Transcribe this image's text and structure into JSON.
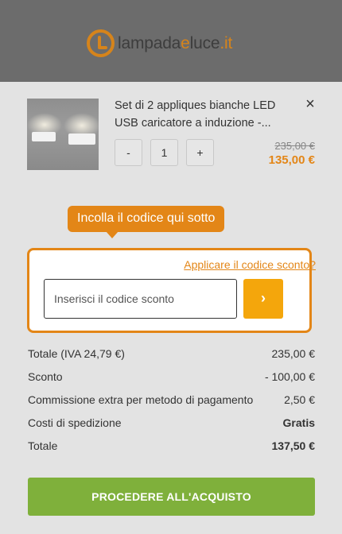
{
  "header": {
    "logo_text_main": "lampada",
    "logo_text_accent": "e",
    "logo_text_main2": "luce",
    "logo_text_tld": ".it"
  },
  "cart_item": {
    "name": "Set di 2 appliques bianche LED USB caricatore a induzione -...",
    "quantity": "1",
    "minus_label": "-",
    "plus_label": "+",
    "remove_label": "×",
    "old_price": "235,00 €",
    "new_price": "135,00 €"
  },
  "tooltip": {
    "text": "Incolla il codice qui sotto"
  },
  "coupon": {
    "link_label": "Applicare il codice sconto?",
    "input_value": "",
    "input_placeholder": "Inserisci il codice sconto",
    "submit_label": "›"
  },
  "summary": {
    "rows": [
      {
        "label": "Totale (IVA 24,79 €)",
        "value": "235,00 €"
      },
      {
        "label": "Sconto",
        "value": "- 100,00 €"
      },
      {
        "label": "Commissione extra per metodo di pagamento",
        "value": "2,50 €"
      },
      {
        "label": "Costi di spedizione",
        "value": "Gratis"
      },
      {
        "label": "Totale",
        "value": "137,50 €"
      }
    ]
  },
  "checkout": {
    "label": "PROCEDERE ALL'ACQUISTO"
  },
  "colors": {
    "accent": "#e38617",
    "button_yellow": "#f4a60c",
    "checkout_green": "#7fb03b",
    "header_bg": "#6c6c6c"
  }
}
